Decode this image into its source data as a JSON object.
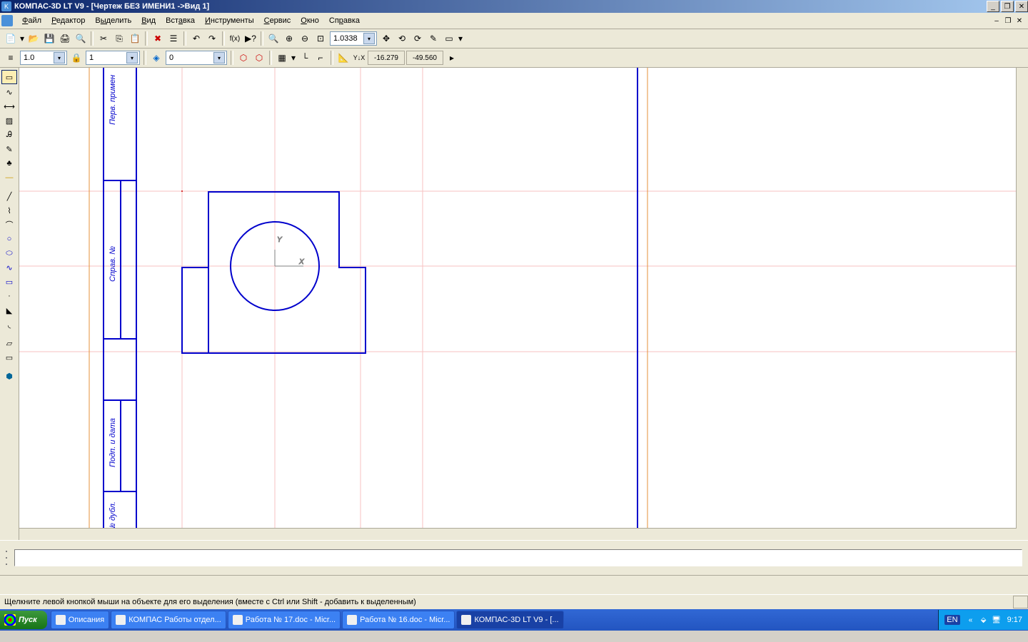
{
  "window": {
    "title": "КОМПАС-3D LT V9 - [Чертеж БЕЗ ИМЕНИ1 ->Вид 1]"
  },
  "menu": {
    "file": "Файл",
    "edit": "Редактор",
    "select": "Выделить",
    "view": "Вид",
    "insert": "Вставка",
    "tools": "Инструменты",
    "service": "Сервис",
    "window": "Окно",
    "help": "Справка"
  },
  "toolbar": {
    "zoom": "1.0338",
    "style_width": "1.0",
    "layer_num": "1",
    "layer2": "0",
    "coord_x": "-16.279",
    "coord_y": "-49.560"
  },
  "canvas": {
    "axis_x": "X",
    "axis_y": "Y",
    "label_top": "Перв. примен",
    "label_mid": "Справ. №",
    "label_low": "Подп. и дата",
    "label_bot": "№ дубл."
  },
  "status": {
    "hint": "Щелкните левой кнопкой мыши на объекте для его выделения (вместе с Ctrl или Shift - добавить к выделенным)"
  },
  "taskbar": {
    "start": "Пуск",
    "items": [
      "Описания",
      "КОМПАС Работы отдел...",
      "Работа № 17.doc - Micr...",
      "Работа № 16.doc - Micr...",
      "КОМПАС-3D LT V9 - [..."
    ],
    "lang": "EN",
    "time": "9:17"
  }
}
